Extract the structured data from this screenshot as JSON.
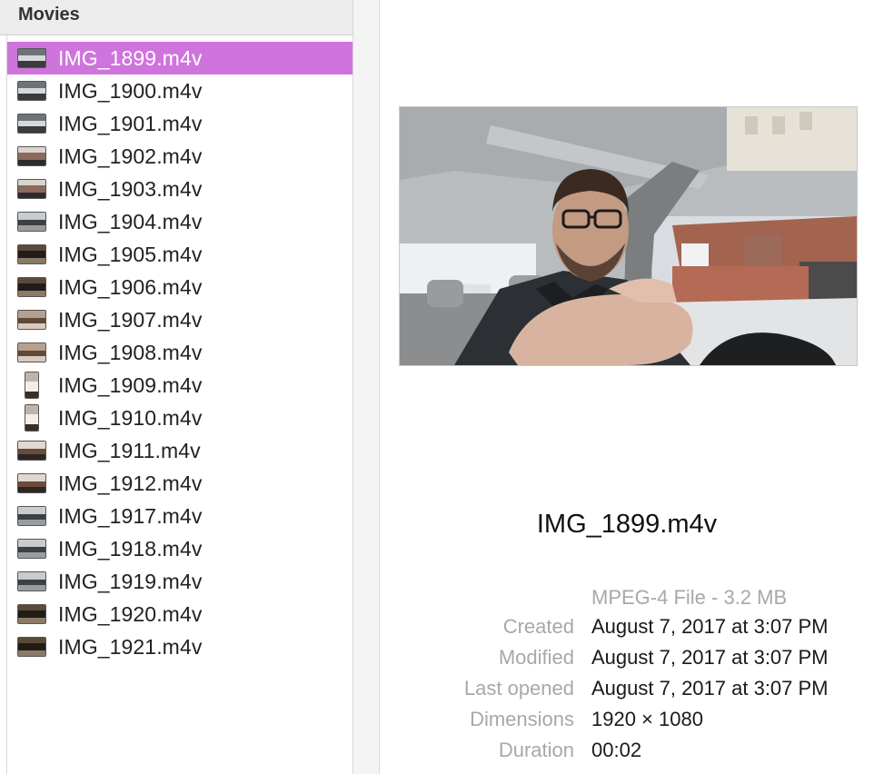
{
  "sidebar": {
    "header": "Movies",
    "selected_color": "#cf74dd",
    "files": [
      {
        "name": "IMG_1899.m4v",
        "selected": true,
        "thumb": "car-selfie",
        "portrait": false
      },
      {
        "name": "IMG_1900.m4v",
        "selected": false,
        "thumb": "car-selfie",
        "portrait": false
      },
      {
        "name": "IMG_1901.m4v",
        "selected": false,
        "thumb": "car-selfie",
        "portrait": false
      },
      {
        "name": "IMG_1902.m4v",
        "selected": false,
        "thumb": "face",
        "portrait": false
      },
      {
        "name": "IMG_1903.m4v",
        "selected": false,
        "thumb": "face",
        "portrait": false
      },
      {
        "name": "IMG_1904.m4v",
        "selected": false,
        "thumb": "building",
        "portrait": false
      },
      {
        "name": "IMG_1905.m4v",
        "selected": false,
        "thumb": "dark",
        "portrait": false
      },
      {
        "name": "IMG_1906.m4v",
        "selected": false,
        "thumb": "dark",
        "portrait": false
      },
      {
        "name": "IMG_1907.m4v",
        "selected": false,
        "thumb": "room",
        "portrait": false
      },
      {
        "name": "IMG_1908.m4v",
        "selected": false,
        "thumb": "room",
        "portrait": false
      },
      {
        "name": "IMG_1909.m4v",
        "selected": false,
        "thumb": "dog",
        "portrait": true
      },
      {
        "name": "IMG_1910.m4v",
        "selected": false,
        "thumb": "dog",
        "portrait": true
      },
      {
        "name": "IMG_1911.m4v",
        "selected": false,
        "thumb": "street",
        "portrait": false
      },
      {
        "name": "IMG_1912.m4v",
        "selected": false,
        "thumb": "street",
        "portrait": false
      },
      {
        "name": "IMG_1917.m4v",
        "selected": false,
        "thumb": "building",
        "portrait": false
      },
      {
        "name": "IMG_1918.m4v",
        "selected": false,
        "thumb": "building",
        "portrait": false
      },
      {
        "name": "IMG_1919.m4v",
        "selected": false,
        "thumb": "building",
        "portrait": false
      },
      {
        "name": "IMG_1920.m4v",
        "selected": false,
        "thumb": "dark",
        "portrait": false
      },
      {
        "name": "IMG_1921.m4v",
        "selected": false,
        "thumb": "dark",
        "portrait": false
      }
    ]
  },
  "preview": {
    "filename": "IMG_1899.m4v",
    "kind": "MPEG-4 File - 3.2 MB",
    "metadata": [
      {
        "label": "Created",
        "value": "August 7, 2017 at 3:07 PM"
      },
      {
        "label": "Modified",
        "value": "August 7, 2017 at 3:07 PM"
      },
      {
        "label": "Last opened",
        "value": "August 7, 2017 at 3:07 PM"
      },
      {
        "label": "Dimensions",
        "value": "1920 × 1080"
      },
      {
        "label": "Duration",
        "value": "00:02"
      }
    ]
  }
}
